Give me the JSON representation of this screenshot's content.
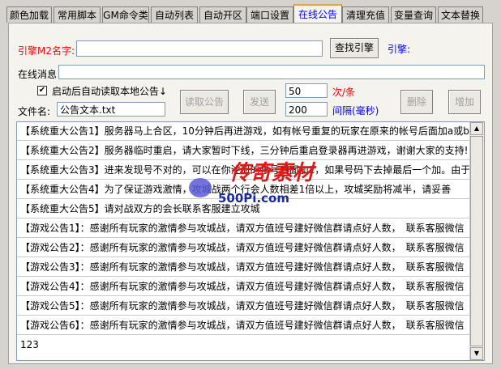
{
  "tabs": [
    "颜色加载",
    "常用脚本",
    "GM命令类",
    "自动列表",
    "自动开区",
    "端口设置",
    "在线公告",
    "清理充值",
    "变量查询",
    "文本替换"
  ],
  "form": {
    "engine_name_label": "引擎M2名字:",
    "engine_name_value": "",
    "find_engine_button": "查找引擎",
    "engine_label": "引擎:",
    "online_msg_label": "在线消息",
    "online_msg_value": "",
    "auto_read_label": "启动后自动读取本地公告↓",
    "auto_read_checked": "✔",
    "filename_label": "文件名:",
    "filename_value": "公告文本.txt",
    "read_button": "读取公告",
    "send_button": "发送",
    "count_value": "50",
    "count_unit": "次/条",
    "interval_value": "200",
    "interval_unit": "间隔(毫秒)",
    "delete_button": "删除",
    "add_button": "增加"
  },
  "announcements": [
    "【系统重大公告1】服务器马上合区，10分钟后再进游戏，如有帐号重复的玩家在原来的帐号后面加a或b",
    "【系统重大公告2】服务器临时重启，请大家暂时下线，三分钟后重启登录器再进游戏，谢谢大家的支持!",
    "【系统重大公告3】进来发现号不对的，可以在你注册的帐号后面加1，如果号码下去掉最后一个加。由于激情人数",
    "【系统重大公告4】为了保证游戏激情，攻城战两个行会人数相差1倍以上，攻城奖励将减半，请妥善",
    "【系统重大公告5】请对战双方的会长联系客服建立攻城",
    "【游戏公告1】：感谢所有玩家的激情参与攻城战，请双方值班号建好微信群请点好人数，　联系客服微信",
    "【游戏公告2】：感谢所有玩家的激情参与攻城战，请双方值班号建好微信群请点好人数，　联系客服微信",
    "【游戏公告3】：感谢所有玩家的激情参与攻城战，请双方值班号建好微信群请点好人数，　联系客服微信",
    "【游戏公告4】：感谢所有玩家的激情参与攻城战，请双方值班号建好微信群请点好人数，　联系客服微信",
    "【游戏公告5】：感谢所有玩家的激情参与攻城战，请双方值班号建好微信群请点好人数，　联系客服微信",
    "【游戏公告6】：感谢所有玩家的激情参与攻城战，请双方值班号建好微信群请点好人数，　联系客服微信",
    "123"
  ],
  "watermark": {
    "line1": "传奇素材",
    "line2": "500Pi.com"
  },
  "colors": {
    "tab_active_text": "#0000ff",
    "tab_active_top": "#e8a437",
    "label_red": "#ff0000",
    "label_blue": "#0000ff"
  }
}
